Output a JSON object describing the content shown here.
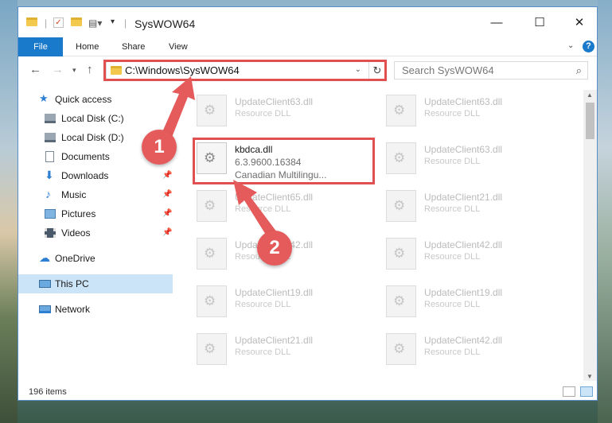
{
  "window": {
    "title": "SysWOW64"
  },
  "ribbon": {
    "tabs": [
      "File",
      "Home",
      "Share",
      "View"
    ]
  },
  "address": {
    "path": "C:\\Windows\\SysWOW64"
  },
  "search": {
    "placeholder": "Search SysWOW64"
  },
  "sidebar": {
    "items": [
      {
        "label": "Quick access",
        "icon": "star-icon",
        "pinned": false
      },
      {
        "label": "Local Disk (C:)",
        "icon": "drive-icon",
        "pinned": false
      },
      {
        "label": "Local Disk (D:)",
        "icon": "drive-icon",
        "pinned": false
      },
      {
        "label": "Documents",
        "icon": "document-icon",
        "pinned": false
      },
      {
        "label": "Downloads",
        "icon": "download-icon",
        "pinned": true
      },
      {
        "label": "Music",
        "icon": "music-icon",
        "pinned": true
      },
      {
        "label": "Pictures",
        "icon": "picture-icon",
        "pinned": true
      },
      {
        "label": "Videos",
        "icon": "video-icon",
        "pinned": true
      },
      {
        "label": "OneDrive",
        "icon": "cloud-icon",
        "pinned": false
      },
      {
        "label": "This PC",
        "icon": "computer-icon",
        "pinned": false,
        "selected": true
      },
      {
        "label": "Network",
        "icon": "network-icon",
        "pinned": false
      }
    ]
  },
  "files": {
    "left": [
      {
        "name": "UpdateClient63.dll",
        "desc": "Resource DLL"
      },
      {
        "name": "UpdateClient65.dll",
        "desc": "Resource DLL"
      },
      {
        "name": "UpdateClient42.dll",
        "desc": "Resource DLL"
      },
      {
        "name": "UpdateClient19.dll",
        "desc": "Resource DLL"
      },
      {
        "name": "UpdateClient21.dll",
        "desc": "Resource DLL"
      },
      {
        "name": "",
        "desc": ""
      }
    ],
    "main": {
      "name": "kbdca.dll",
      "version": "6.3.9600.16384",
      "desc": "Canadian Multilingu..."
    },
    "right": [
      {
        "name": "UpdateClient63.dll",
        "desc": "Resource DLL"
      },
      {
        "name": "UpdateClient63.dll",
        "desc": "Resource DLL"
      },
      {
        "name": "UpdateClient21.dll",
        "desc": "Resource DLL"
      },
      {
        "name": "UpdateClient42.dll",
        "desc": "Resource DLL"
      },
      {
        "name": "UpdateClient19.dll",
        "desc": "Resource DLL"
      },
      {
        "name": "UpdateClient42.dll",
        "desc": "Resource DLL"
      },
      {
        "name": "",
        "desc": ""
      }
    ]
  },
  "status": {
    "count": "196 items"
  },
  "annotations": {
    "step1": "1",
    "step2": "2",
    "color": "#e55b5b"
  }
}
